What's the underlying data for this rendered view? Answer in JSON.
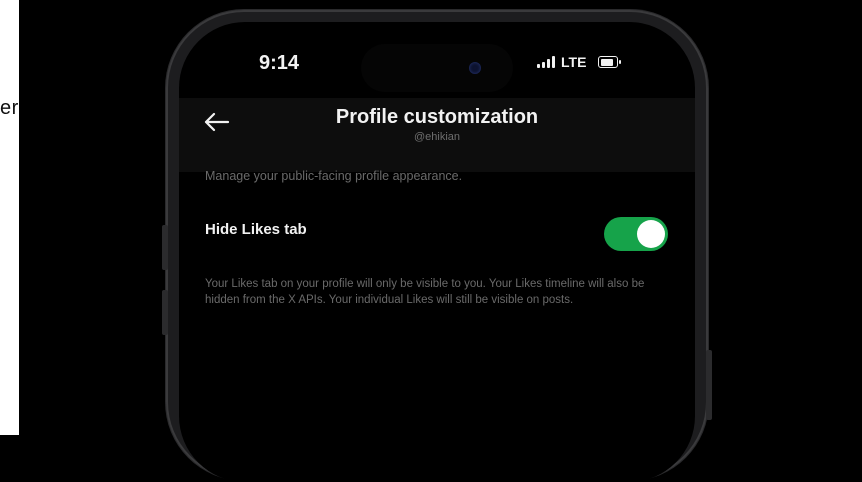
{
  "left_text": "er",
  "status_bar": {
    "time": "9:14",
    "network": "LTE"
  },
  "header": {
    "title": "Profile customization",
    "handle": "@ehikian"
  },
  "content": {
    "description": "Manage your public-facing profile appearance.",
    "setting": {
      "label": "Hide Likes tab",
      "enabled": true
    },
    "help_text": "Your Likes tab on your profile will only be visible to you. Your Likes timeline will also be hidden from the X APIs. Your individual Likes will still be visible on posts."
  },
  "colors": {
    "toggle_on": "#16a34a",
    "background": "#000000"
  },
  "icons": {
    "back": "arrow-left-icon",
    "signal": "signal-icon",
    "battery": "battery-icon"
  }
}
